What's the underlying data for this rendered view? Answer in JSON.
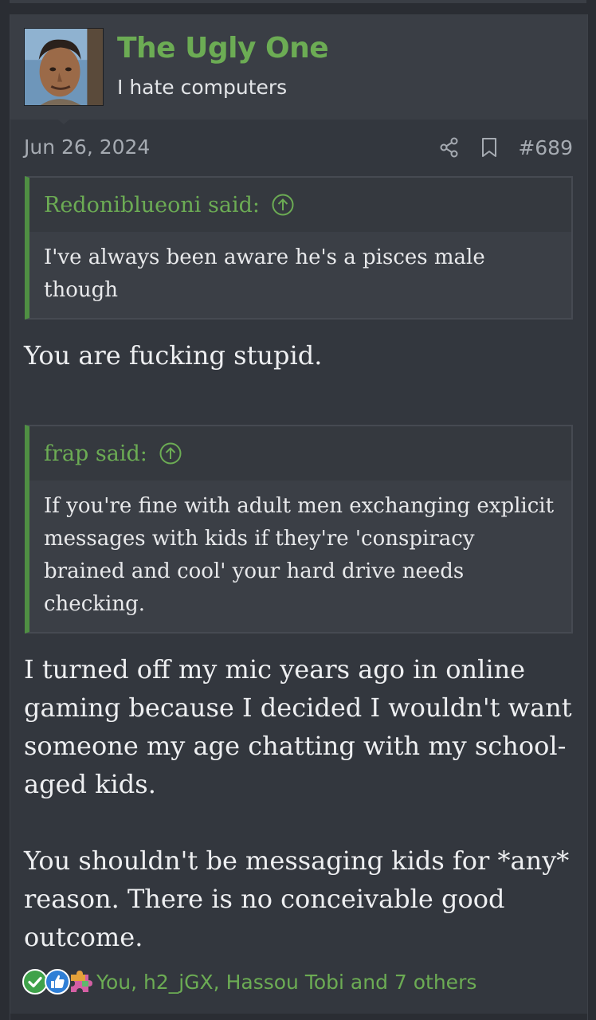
{
  "post": {
    "username": "The Ugly One",
    "user_title": "I hate computers",
    "date": "Jun 26, 2024",
    "post_number": "#689",
    "quotes": [
      {
        "author": "Redoniblueoni said:",
        "text": "I've always been aware he's a pisces male though"
      },
      {
        "author": "frap said:",
        "text": "If you're fine with adult men exchanging explicit messages with kids if they're 'conspiracy brained and cool' your hard drive needs checking."
      }
    ],
    "reply_1": "You are fucking stupid.",
    "reply_2": "I turned off my mic years ago in online gaming because I decided I wouldn't want someone my age chatting with my school-aged kids.",
    "reply_3": "You shouldn't be messaging kids for *any* reason. There is no conceivable good outcome.",
    "reactions_text": "You, h2_jGX, Hassou Tobi and 7 others",
    "reaction_icons": [
      "check-reaction-icon",
      "like-reaction-icon",
      "puzzle-reaction-icon"
    ]
  },
  "colors": {
    "accent_green": "#6cac54",
    "quote_border": "#4f8f43",
    "background": "#33373e"
  }
}
